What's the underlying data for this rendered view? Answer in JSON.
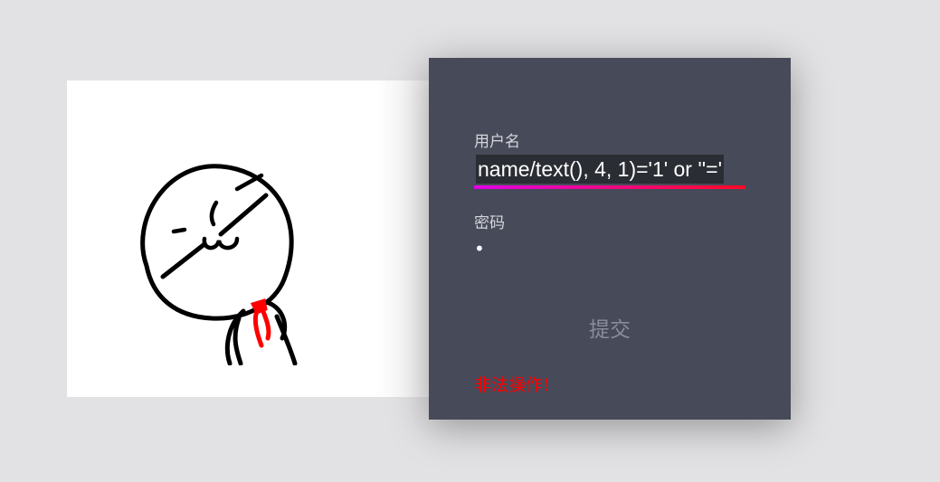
{
  "form": {
    "username_label": "用户名",
    "username_value": "name/text(), 4, 1)='1'  or ''='",
    "password_label": "密码",
    "password_value": "•",
    "submit_label": "提交",
    "error_message": "非法操作!"
  },
  "colors": {
    "background": "#e2e2e4",
    "panel": "#474a59",
    "underline_start": "#e100e7",
    "underline_end": "#ff0a24",
    "error": "#ff0000"
  },
  "icons": {
    "sticker": "smirking-stick-figure-with-red-tie"
  }
}
